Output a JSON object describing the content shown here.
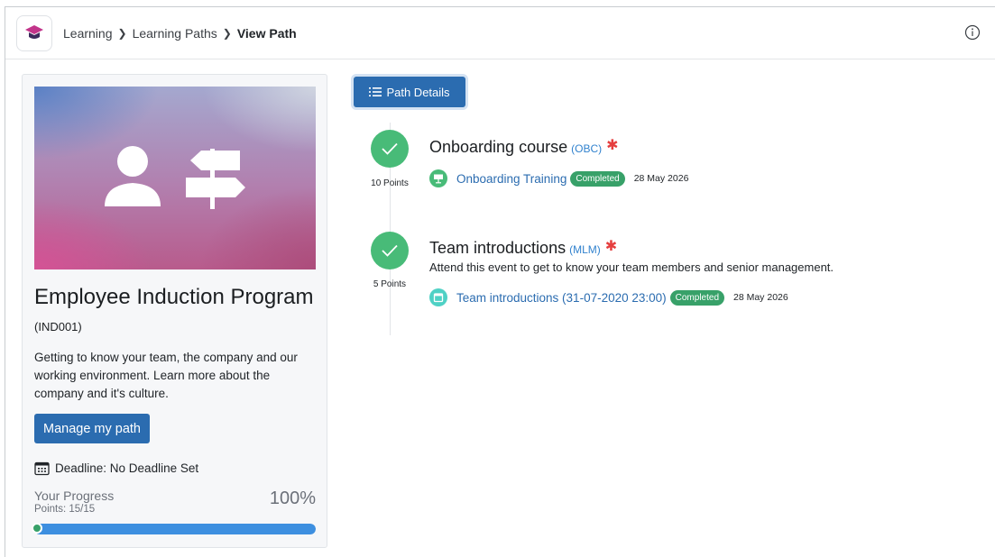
{
  "breadcrumb": {
    "items": [
      "Learning",
      "Learning Paths"
    ],
    "current": "View Path"
  },
  "path": {
    "title": "Employee Induction Program",
    "code": "(IND001)",
    "description": "Getting to know your team, the company and our working environment. Learn more about the company and it's culture.",
    "manage_label": "Manage my path",
    "deadline": "Deadline: No Deadline Set",
    "progress": {
      "label": "Your Progress",
      "points": "Points: 15/15",
      "percent_text": "100%",
      "fraction": 1.0
    }
  },
  "path_details_label": "Path Details",
  "steps": [
    {
      "title": "Onboarding course",
      "code": "(OBC)",
      "points": "10 Points",
      "description": "",
      "items": [
        {
          "label": "Onboarding Training",
          "status": "Completed",
          "date": "28 May 2026",
          "icon": "presentation-icon",
          "icon_color": "#48bb78"
        }
      ]
    },
    {
      "title": "Team introductions",
      "code": "(MLM)",
      "points": "5 Points",
      "description": "Attend this event to get to know your team members and senior management.",
      "items": [
        {
          "label": "Team introductions (31-07-2020 23:00)",
          "status": "Completed",
          "date": "28 May 2026",
          "icon": "calendar-icon",
          "icon_color": "#4fd1c5"
        }
      ]
    }
  ],
  "colors": {
    "primary": "#2b6cb0",
    "success": "#48bb78",
    "badge": "#38a169",
    "required": "#e53e3e",
    "link": "#2b6cb0"
  }
}
